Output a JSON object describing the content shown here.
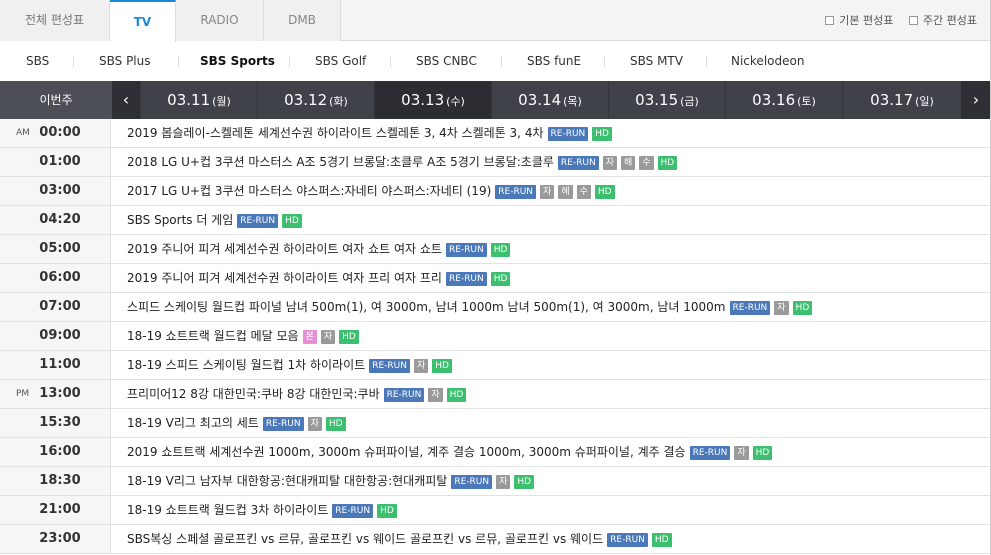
{
  "top_tabs": [
    "전체 편성표",
    "TV",
    "RADIO",
    "DMB"
  ],
  "view_options": [
    "기본 편성표",
    "주간 편성표"
  ],
  "channels": [
    "SBS",
    "SBS Plus",
    "SBS Sports",
    "SBS Golf",
    "SBS CNBC",
    "SBS funE",
    "SBS MTV",
    "Nickelodeon"
  ],
  "this_week": "이번주",
  "nav": {
    "prev": "‹",
    "next": "›"
  },
  "days": [
    {
      "date": "03.11",
      "weekday": "(월)"
    },
    {
      "date": "03.12",
      "weekday": "(화)"
    },
    {
      "date": "03.13",
      "weekday": "(수)"
    },
    {
      "date": "03.14",
      "weekday": "(목)"
    },
    {
      "date": "03.15",
      "weekday": "(금)"
    },
    {
      "date": "03.16",
      "weekday": "(토)"
    },
    {
      "date": "03.17",
      "weekday": "(일)"
    }
  ],
  "schedule": [
    {
      "ampm": "AM",
      "time": "00:00",
      "title": "2019 봅슬레이-스켈레톤 세계선수권 하이라이트 스켈레톤 3, 4차 스켈레톤 3, 4차",
      "tags": [
        "RE-RUN",
        "HD"
      ]
    },
    {
      "ampm": "",
      "time": "01:00",
      "title": "2018 LG U+컵 3쿠션 마스터스 A조 5경기 브롱달:초클루 A조 5경기 브롱달:초클루",
      "tags": [
        "RE-RUN",
        "자",
        "해",
        "수",
        "HD"
      ]
    },
    {
      "ampm": "",
      "time": "03:00",
      "title": "2017 LG U+컵 3쿠션 마스터스 야스퍼스:자네티 야스퍼스:자네티 (19)",
      "tags": [
        "RE-RUN",
        "자",
        "해",
        "수",
        "HD"
      ]
    },
    {
      "ampm": "",
      "time": "04:20",
      "title": "SBS Sports 더 게임",
      "tags": [
        "RE-RUN",
        "HD"
      ]
    },
    {
      "ampm": "",
      "time": "05:00",
      "title": "2019 주니어 피겨 세계선수권 하이라이트 여자 쇼트 여자 쇼트",
      "tags": [
        "RE-RUN",
        "HD"
      ]
    },
    {
      "ampm": "",
      "time": "06:00",
      "title": "2019 주니어 피겨 세계선수권 하이라이트 여자 프리 여자 프리",
      "tags": [
        "RE-RUN",
        "HD"
      ]
    },
    {
      "ampm": "",
      "time": "07:00",
      "title": "스피드 스케이팅 월드컵 파이널 남녀 500m(1), 여 3000m, 남녀 1000m 남녀 500m(1), 여 3000m, 남녀 1000m",
      "tags": [
        "RE-RUN",
        "자",
        "HD"
      ]
    },
    {
      "ampm": "",
      "time": "09:00",
      "title": "18-19 쇼트트랙 월드컵 메달 모음",
      "tags": [
        "본",
        "자",
        "HD"
      ]
    },
    {
      "ampm": "",
      "time": "11:00",
      "title": "18-19 스피드 스케이팅 월드컵 1차 하이라이트",
      "tags": [
        "RE-RUN",
        "자",
        "HD"
      ]
    },
    {
      "ampm": "PM",
      "time": "13:00",
      "title": "프리미어12 8강 대한민국:쿠바 8강 대한민국:쿠바",
      "tags": [
        "RE-RUN",
        "자",
        "HD"
      ]
    },
    {
      "ampm": "",
      "time": "15:30",
      "title": "18-19 V리그 최고의 세트",
      "tags": [
        "RE-RUN",
        "자",
        "HD"
      ]
    },
    {
      "ampm": "",
      "time": "16:00",
      "title": "2019 쇼트트랙 세계선수권 1000m, 3000m 슈퍼파이널, 계주 결승 1000m, 3000m 슈퍼파이널, 계주 결승",
      "tags": [
        "RE-RUN",
        "자",
        "HD"
      ]
    },
    {
      "ampm": "",
      "time": "18:30",
      "title": "18-19 V리그 남자부 대한항공:현대캐피탈 대한항공:현대캐피탈",
      "tags": [
        "RE-RUN",
        "자",
        "HD"
      ]
    },
    {
      "ampm": "",
      "time": "21:00",
      "title": "18-19 쇼트트랙 월드컵 3차 하이라이트",
      "tags": [
        "RE-RUN",
        "HD"
      ]
    },
    {
      "ampm": "",
      "time": "23:00",
      "title": "SBS복싱 스페셜 골로프킨 vs 르뮤, 골로프킨 vs 웨이드 골로프킨 vs 르뮤, 골로프킨 vs 웨이드",
      "tags": [
        "RE-RUN",
        "HD"
      ]
    }
  ],
  "colors": {
    "accent": "#1a8ad6",
    "datebar": "#40424a",
    "rerun": "#4a78b8",
    "hd": "#3cbf6e",
    "sub": "#9a9a9a",
    "dub": "#e68fd2"
  }
}
